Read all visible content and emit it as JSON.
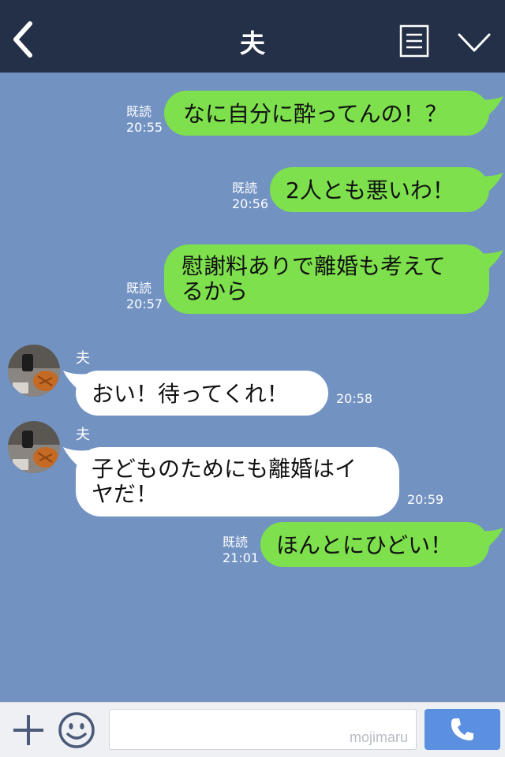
{
  "header": {
    "title": "夫"
  },
  "messages": [
    {
      "type": "mine",
      "read_label": "既読",
      "time": "20:55",
      "text": "なに自分に酔ってんの！？"
    },
    {
      "type": "mine",
      "read_label": "既読",
      "time": "20:56",
      "text": "2人とも悪いわ！"
    },
    {
      "type": "mine",
      "read_label": "既読",
      "time": "20:57",
      "lines": [
        "慰謝料ありで離婚も考えて",
        "るから"
      ]
    },
    {
      "type": "theirs",
      "sender": "夫",
      "time": "20:58",
      "text": "おい！待ってくれ！"
    },
    {
      "type": "theirs",
      "sender": "夫",
      "time": "20:59",
      "lines": [
        "子どものためにも離婚はイ",
        "ヤだ！"
      ]
    },
    {
      "type": "mine",
      "read_label": "既読",
      "time": "21:01",
      "text": "ほんとにひどい！"
    }
  ],
  "input": {
    "watermark": "mojimaru"
  },
  "colors": {
    "header_bg": "#243047",
    "chat_bg": "#7292c2",
    "mine_bubble": "#7de04c",
    "theirs_bubble": "#ffffff",
    "call_button": "#5b8fe0"
  },
  "icons": [
    "back-arrow-icon",
    "notes-icon",
    "chevron-down-icon",
    "plus-icon",
    "emoji-icon",
    "phone-icon"
  ]
}
